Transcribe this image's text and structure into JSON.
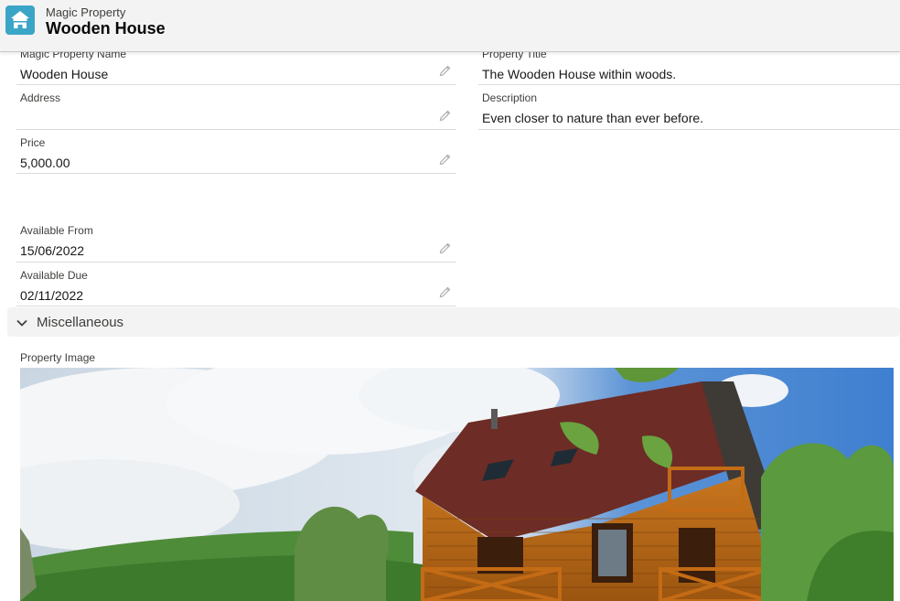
{
  "header": {
    "object_label": "Magic Property",
    "record_title": "Wooden House",
    "icon": "home-icon"
  },
  "fields": {
    "name": {
      "label": "Magic Property Name",
      "value": "Wooden House"
    },
    "property_title": {
      "label": "Property Title",
      "value": "The Wooden House within woods."
    },
    "address": {
      "label": "Address",
      "value": ""
    },
    "description": {
      "label": "Description",
      "value": "Even closer to nature than ever before."
    },
    "price": {
      "label": "Price",
      "value": "5,000.00"
    },
    "available_from": {
      "label": "Available From",
      "value": "15/06/2022"
    },
    "available_due": {
      "label": "Available Due",
      "value": "02/11/2022"
    }
  },
  "section": {
    "label": "Miscellaneous",
    "icon": "chevron-down-icon"
  },
  "image_field": {
    "label": "Property Image",
    "alt": "wooden-house-photo"
  },
  "colors": {
    "brand_icon": "#3ba5c7",
    "header_bg": "#f3f3f3",
    "divider": "#dddbda"
  }
}
